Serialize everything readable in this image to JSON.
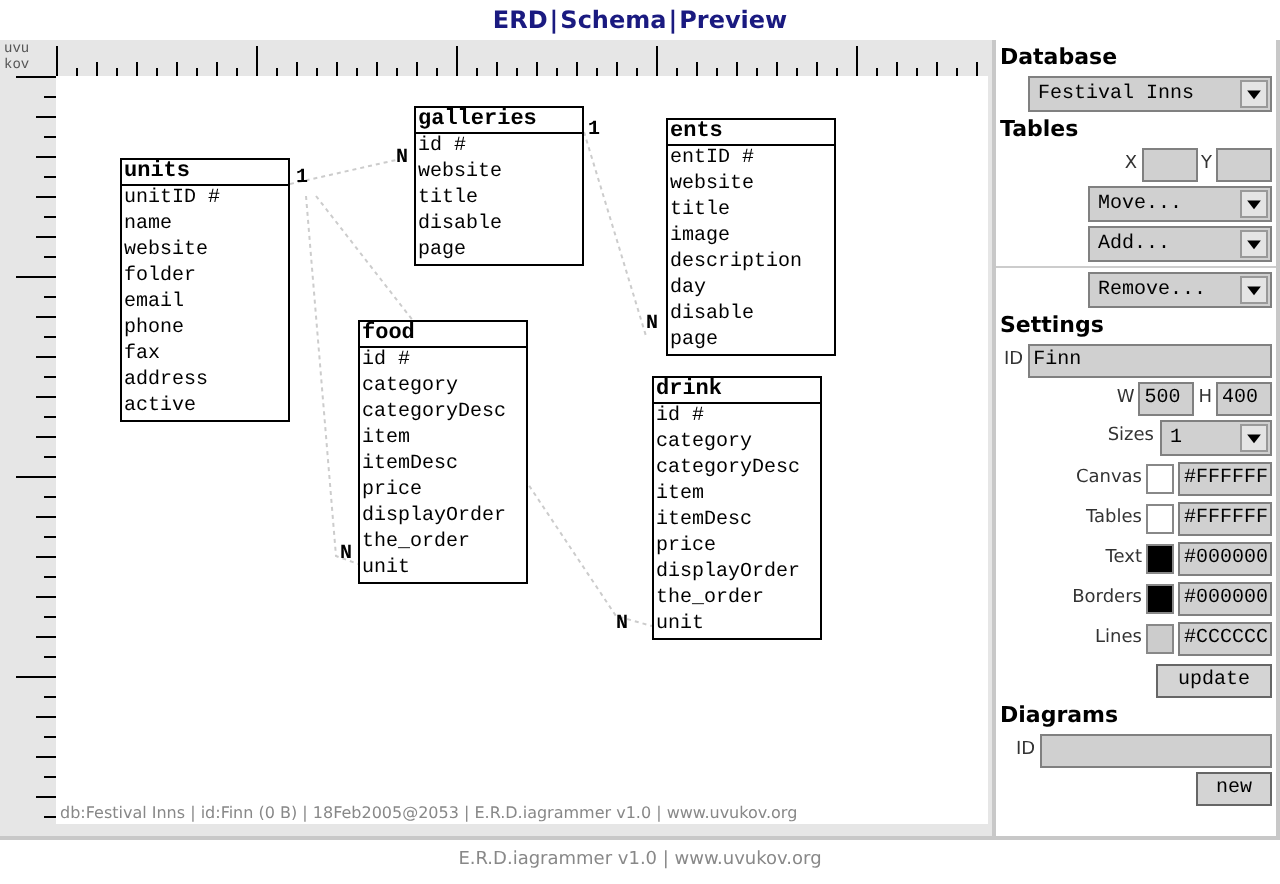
{
  "nav": [
    {
      "label": "ERD",
      "separator_after": "|"
    },
    {
      "label": "Schema",
      "separator_after": "|"
    },
    {
      "label": "Preview"
    }
  ],
  "ruler_corner": [
    "uvu",
    "kov"
  ],
  "tables": [
    {
      "name": "units",
      "fields": [
        "unitID #",
        "name",
        "website",
        "folder",
        "email",
        "phone",
        "fax",
        "address",
        "active"
      ]
    },
    {
      "name": "galleries",
      "fields": [
        "id #",
        "website",
        "title",
        "disable",
        "page"
      ]
    },
    {
      "name": "ents",
      "fields": [
        "entID #",
        "website",
        "title",
        "image",
        "description",
        "day",
        "disable",
        "page"
      ]
    },
    {
      "name": "food",
      "fields": [
        "id #",
        "category",
        "categoryDesc",
        "item",
        "itemDesc",
        "price",
        "displayOrder",
        "the_order",
        "unit"
      ]
    },
    {
      "name": "drink",
      "fields": [
        "id #",
        "category",
        "categoryDesc",
        "item",
        "itemDesc",
        "price",
        "displayOrder",
        "the_order",
        "unit"
      ]
    }
  ],
  "relationships": [
    {
      "from_card": "1",
      "to_card": "N"
    },
    {
      "from_card": "1",
      "to_card": "N"
    },
    {
      "to_card": "N"
    },
    {
      "to_card": "N"
    }
  ],
  "status_line": "db:Festival Inns | id:Finn (0 B) | 18Feb2005@2053 | E.R.D.iagrammer v1.0 | www.uvukov.org",
  "sidebar": {
    "database": {
      "title": "Database",
      "select": "Festival Inns"
    },
    "tables": {
      "title": "Tables",
      "x_label": "X",
      "y_label": "Y",
      "move": "Move...",
      "add": "Add...",
      "remove": "Remove..."
    },
    "settings": {
      "title": "Settings",
      "id_label": "ID",
      "id_value": "Finn",
      "w_label": "W",
      "w_value": "500",
      "h_label": "H",
      "h_value": "400",
      "sizes_label": "Sizes",
      "sizes_value": "1",
      "colors": [
        {
          "label": "Canvas",
          "color": "#ffffff",
          "value": "#FFFFFF"
        },
        {
          "label": "Tables",
          "color": "#ffffff",
          "value": "#FFFFFF"
        },
        {
          "label": "Text",
          "color": "#000000",
          "value": "#000000"
        },
        {
          "label": "Borders",
          "color": "#000000",
          "value": "#000000"
        },
        {
          "label": "Lines",
          "color": "#cccccc",
          "value": "#CCCCCC"
        }
      ],
      "update": "update"
    },
    "diagrams": {
      "title": "Diagrams",
      "id_label": "ID",
      "new": "new"
    }
  },
  "footer": "E.R.D.iagrammer v1.0 | www.uvukov.org"
}
